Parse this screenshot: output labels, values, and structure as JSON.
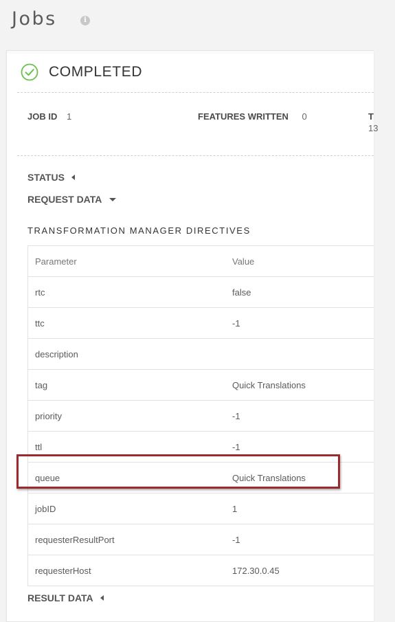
{
  "page": {
    "title": "Jobs",
    "info_icon": "i"
  },
  "job": {
    "status": "COMPLETED",
    "job_id_label": "JOB ID",
    "job_id_value": "1",
    "features_written_label": "FEATURES WRITTEN",
    "features_written_value": "0",
    "truncated_label": "T",
    "truncated_value": "13"
  },
  "sections": {
    "status": "STATUS",
    "request_data": "REQUEST DATA",
    "result_data": "RESULT DATA"
  },
  "directives": {
    "title": "TRANSFORMATION MANAGER DIRECTIVES",
    "columns": [
      "Parameter",
      "Value"
    ],
    "rows": [
      {
        "param": "rtc",
        "value": "false"
      },
      {
        "param": "ttc",
        "value": "-1"
      },
      {
        "param": "description",
        "value": ""
      },
      {
        "param": "tag",
        "value": "Quick Translations"
      },
      {
        "param": "priority",
        "value": "-1"
      },
      {
        "param": "ttl",
        "value": "-1"
      },
      {
        "param": "queue",
        "value": "Quick Translations"
      },
      {
        "param": "jobID",
        "value": "1"
      },
      {
        "param": "requesterResultPort",
        "value": "-1"
      },
      {
        "param": "requesterHost",
        "value": "172.30.0.45"
      }
    ]
  },
  "colors": {
    "success_green": "#6cbf4f",
    "highlight_red": "#9b2a2e"
  },
  "icons": {
    "status_icon": "check-circle-icon",
    "info_icon": "info-icon"
  }
}
